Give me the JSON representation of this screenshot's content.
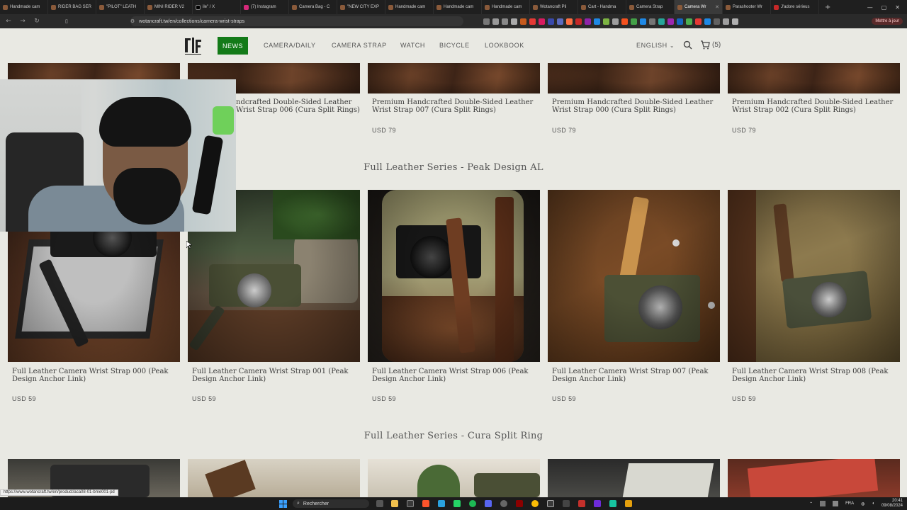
{
  "browser": {
    "tabs": [
      {
        "label": "Handmade cam",
        "active": false
      },
      {
        "label": "RIDER BAG SER",
        "active": false
      },
      {
        "label": "\"PILOT\" LEATH",
        "active": false
      },
      {
        "label": "MINI RIDER V2",
        "active": false
      },
      {
        "label": "ile\" / X",
        "active": false
      },
      {
        "label": "(7) Instagram",
        "active": false
      },
      {
        "label": "Camera Bag - C",
        "active": false
      },
      {
        "label": "\"NEW CITY EXP",
        "active": false
      },
      {
        "label": "Handmade cam",
        "active": false
      },
      {
        "label": "Handmade cam",
        "active": false
      },
      {
        "label": "Handmade cam",
        "active": false
      },
      {
        "label": "Wotancraft Pil",
        "active": false
      },
      {
        "label": "Cart - Handma",
        "active": false
      },
      {
        "label": "Camera Strap",
        "active": false
      },
      {
        "label": "Camera Wr",
        "active": true
      },
      {
        "label": "Parashooter Wr",
        "active": false
      },
      {
        "label": "J'adore sérieus",
        "active": false
      }
    ],
    "url": "wotancraft.tw/en/collections/camera-wrist-straps",
    "update_label": "Mettre à jour",
    "status_url": "https://www.wotancraft.tw/en/product/aca08-01-bme001-pd"
  },
  "header": {
    "news_label": "NEWS",
    "nav": [
      "CAMERA/DAILY",
      "CAMERA STRAP",
      "WATCH",
      "BICYCLE",
      "LOOKBOOK"
    ],
    "language": "ENGLISH",
    "cart_count": "(5)"
  },
  "top_row": {
    "products": [
      {
        "title": "",
        "price": ""
      },
      {
        "title": "ndcrafted Double-Sided Leather Wrist Strap 006 (Cura Split Rings)",
        "price": ""
      },
      {
        "title": "Premium Handcrafted Double-Sided Leather Wrist Strap 007 (Cura Split Rings)",
        "price": "USD 79"
      },
      {
        "title": "Premium Handcrafted Double-Sided Leather Wrist Strap 000 (Cura Split Rings)",
        "price": "USD 79"
      },
      {
        "title": "Premium Handcrafted Double-Sided Leather Wrist Strap 002 (Cura Split Rings)",
        "price": "USD 79"
      }
    ]
  },
  "section_peak": {
    "title": "Full Leather Series - Peak Design AL",
    "products": [
      {
        "title": "Full Leather Camera Wrist Strap 000 (Peak Design Anchor Link)",
        "price": "USD 59"
      },
      {
        "title": "Full Leather Camera Wrist Strap 001 (Peak Design Anchor Link)",
        "price": "USD 59"
      },
      {
        "title": "Full Leather Camera Wrist Strap 006 (Peak Design Anchor Link)",
        "price": "USD 59"
      },
      {
        "title": "Full Leather Camera Wrist Strap 007 (Peak Design Anchor Link)",
        "price": "USD 59"
      },
      {
        "title": "Full Leather Camera Wrist Strap 008 (Peak Design Anchor Link)",
        "price": "USD 59"
      }
    ]
  },
  "section_cura": {
    "title": "Full Leather Series - Cura Split Ring"
  },
  "taskbar": {
    "search_label": "Rechercher",
    "lang": "FRA",
    "time": "20:41",
    "date": "09/08/2024"
  }
}
